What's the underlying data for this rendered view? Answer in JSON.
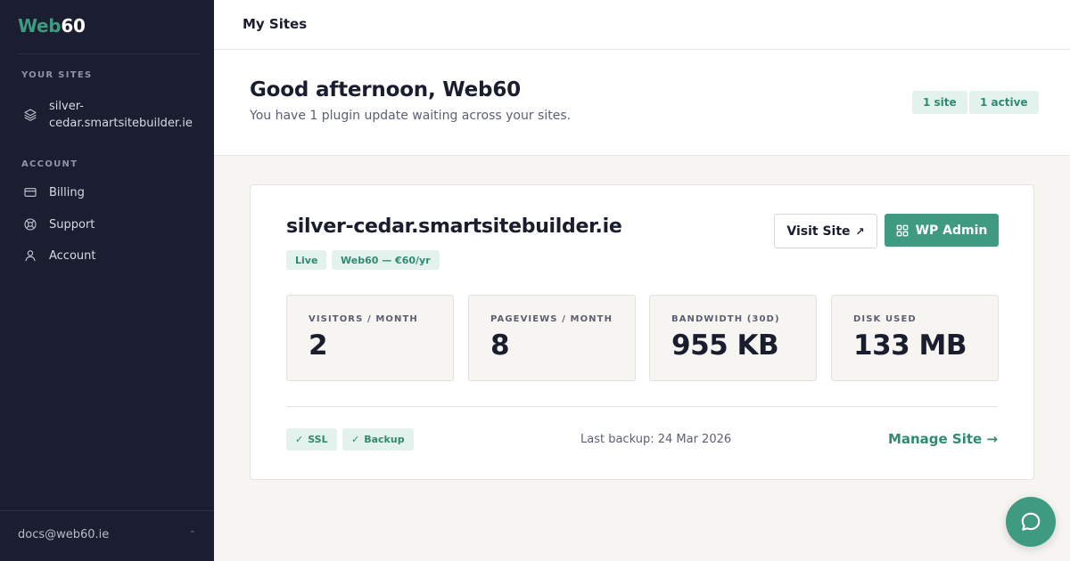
{
  "brand": {
    "part1": "Web",
    "part2": "60"
  },
  "sidebar": {
    "sites_heading": "YOUR SITES",
    "site_item": {
      "label": "silver-cedar.smartsitebuilder.ie",
      "icon": "layers-icon"
    },
    "account_heading": "ACCOUNT",
    "items": [
      {
        "label": "Billing",
        "icon": "credit-card-icon"
      },
      {
        "label": "Support",
        "icon": "lifebuoy-icon"
      },
      {
        "label": "Account",
        "icon": "user-icon"
      }
    ],
    "footer_email": "docs@web60.ie",
    "footer_chevron": "⌃"
  },
  "topbar": {
    "title": "My Sites"
  },
  "greeting": {
    "title": "Good afternoon, Web60",
    "subtitle": "You have 1 plugin update waiting across your sites.",
    "badges": [
      "1 site",
      "1 active"
    ]
  },
  "site_card": {
    "domain": "silver-cedar.smartsitebuilder.ie",
    "status_tag": "Live",
    "plan_tag": "Web60 — €60/yr",
    "visit_button": "Visit Site",
    "visit_arrow": "↗",
    "admin_button": "WP Admin",
    "stats": [
      {
        "label": "VISITORS / MONTH",
        "value": "2"
      },
      {
        "label": "PAGEVIEWS / MONTH",
        "value": "8"
      },
      {
        "label": "BANDWIDTH (30D)",
        "value": "955 KB"
      },
      {
        "label": "DISK USED",
        "value": "133 MB"
      }
    ],
    "features": [
      {
        "check": "✓",
        "label": "SSL"
      },
      {
        "check": "✓",
        "label": "Backup"
      }
    ],
    "last_backup": "Last backup: 24 Mar 2026",
    "manage_link": "Manage Site →"
  },
  "colors": {
    "sidebar_bg": "#1b1d30",
    "accent": "#3e9b82",
    "tag_bg": "#e3f2ec",
    "page_bg": "#f6f5f1"
  }
}
